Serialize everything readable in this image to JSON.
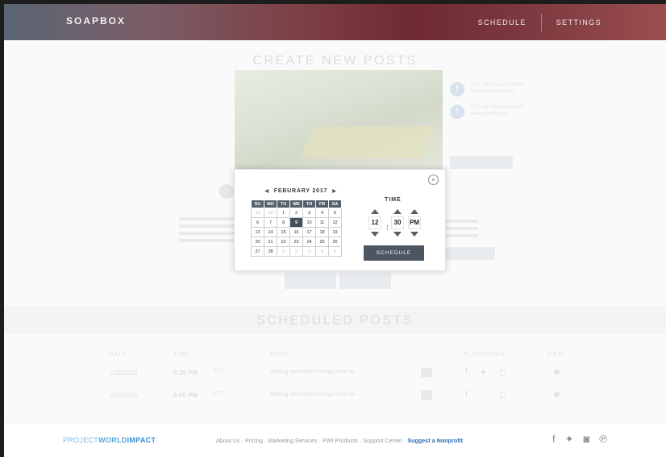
{
  "header": {
    "logo": "SOAPBOX",
    "nav": [
      "SCHEDULE",
      "SETTINGS"
    ]
  },
  "create": {
    "title": "CREATE NEW POSTS",
    "social": [
      {
        "icon": "facebook-icon",
        "text": "CITY OF FALLEN ROCK\nfacebook.com/cityof"
      },
      {
        "icon": "twitter-icon",
        "text": "CITY OF FALLEN ROCK\ntwitter.com/cityof"
      }
    ]
  },
  "scheduled": {
    "title": "SCHEDULED POSTS",
    "headers": [
      "DATE",
      "TIME",
      "POST",
      "PLATFORMS",
      "VIEW"
    ],
    "rows": [
      {
        "date": "1/15/2016",
        "time": "3:30 PM",
        "tz": "EST",
        "post": "Making someone's things here for ..."
      },
      {
        "date": "1/15/2016",
        "time": "4:00 PM",
        "tz": "EST",
        "post": "Making someone's things here for ..."
      }
    ]
  },
  "modal": {
    "month_label": "FEBURARY 2017",
    "weekdays": [
      "SU",
      "MO",
      "TU",
      "WE",
      "TH",
      "FR",
      "SA"
    ],
    "weeks": [
      [
        "29",
        "30",
        "1",
        "2",
        "3",
        "4",
        "5"
      ],
      [
        "6",
        "7",
        "8",
        "9",
        "10",
        "11",
        "12"
      ],
      [
        "13",
        "14",
        "15",
        "16",
        "17",
        "18",
        "19"
      ],
      [
        "20",
        "21",
        "22",
        "23",
        "24",
        "25",
        "26"
      ],
      [
        "27",
        "28",
        "1",
        "2",
        "3",
        "4",
        "5"
      ]
    ],
    "selected_day": "9",
    "time_label": "TIME",
    "hour": "12",
    "minute": "30",
    "period": "PM",
    "colon": ":",
    "schedule_label": "SCHEDULE"
  },
  "footer": {
    "logo_a": "PROJECT",
    "logo_b": "WORLD",
    "logo_c": "IMPACT",
    "links": [
      "About Us",
      "Pricing",
      "Marketing Services",
      "PWI Products",
      "Support Center"
    ],
    "highlight_link": "Suggest a Nonprofit",
    "separator": " · ",
    "social": [
      "facebook-icon",
      "twitter-icon",
      "instagram-icon",
      "pinterest-icon"
    ]
  },
  "colors": {
    "dark_button": "#4b5661",
    "selected_day": "#454f5a",
    "footer_link": "#2a6fb5"
  }
}
